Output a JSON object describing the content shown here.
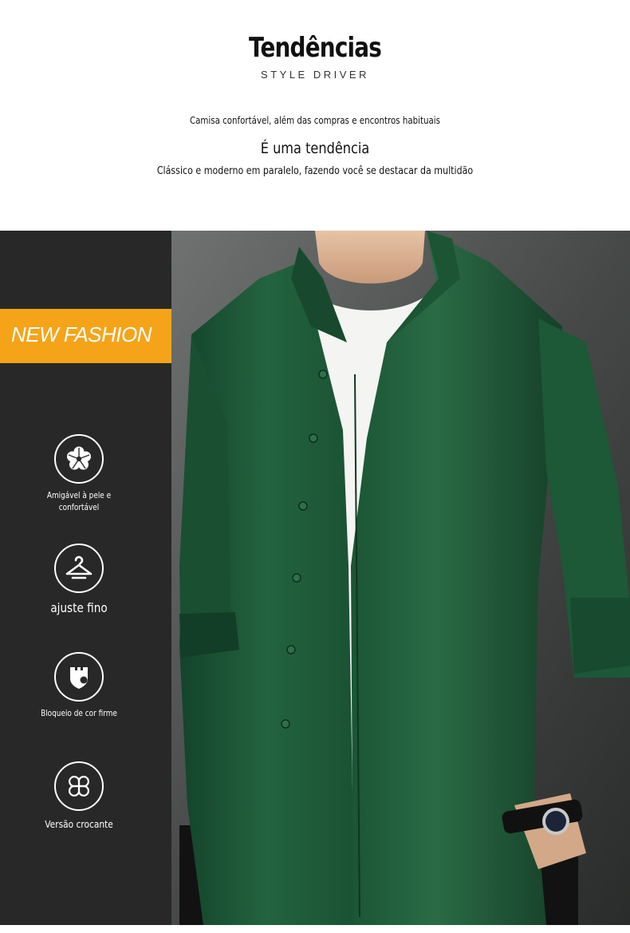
{
  "header": {
    "title": "Tendências",
    "subtitle": "STYLE DRIVER",
    "line1": "Camisa confortável, além das compras e encontros habituais",
    "line2": "É uma tendência",
    "line3": "Clássico e moderno em paralelo, fazendo você se destacar da multidão"
  },
  "banner": {
    "label": "NEW FASHION",
    "color": "#f5a419"
  },
  "features": [
    {
      "icon": "flower-icon",
      "label": "Amigável à pele e confortável"
    },
    {
      "icon": "hanger-icon",
      "label": "ajuste fino"
    },
    {
      "icon": "shield-icon",
      "label": "Bloqueio de cor firme"
    },
    {
      "icon": "clover-icon",
      "label": "Versão crocante"
    }
  ],
  "colors": {
    "panel": "#2b2b2b",
    "shirt": "#1f5a3a",
    "accent": "#f5a419"
  }
}
